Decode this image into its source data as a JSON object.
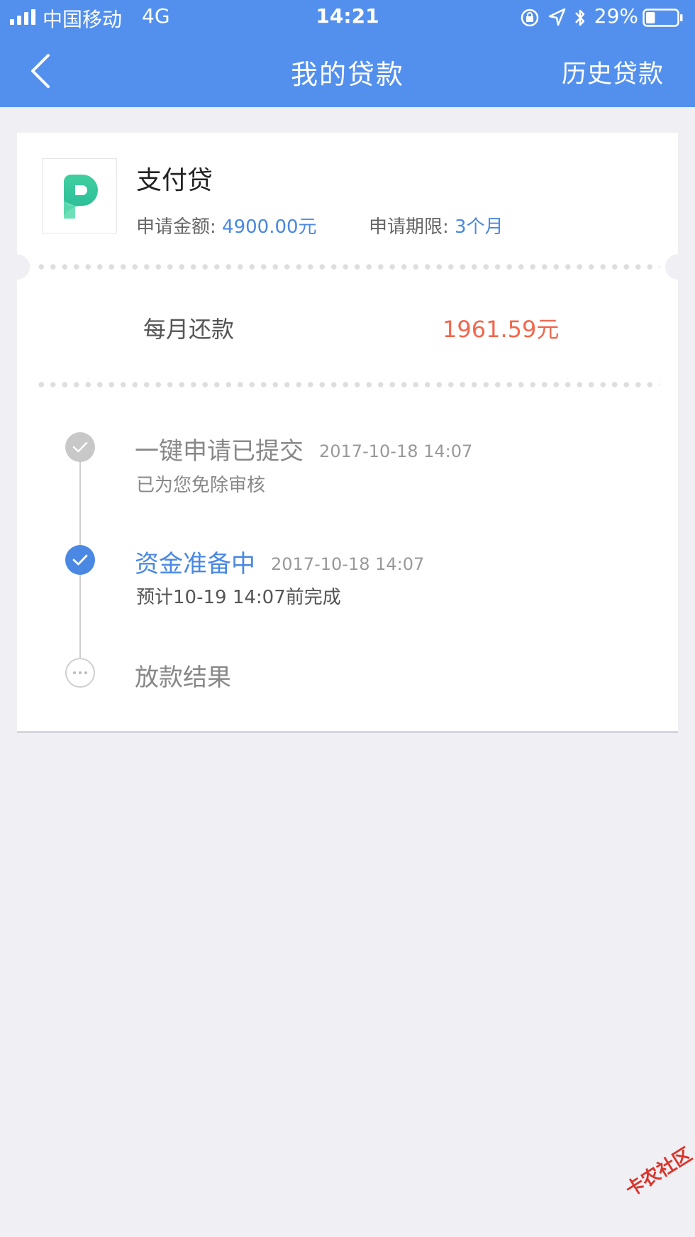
{
  "status_bar": {
    "carrier": "中国移动",
    "network": "4G",
    "time": "14:21",
    "battery_percent": "29%",
    "battery_level": 0.29
  },
  "nav": {
    "title": "我的贷款",
    "history_label": "历史贷款",
    "back_icon": "chevron-left-icon"
  },
  "loan": {
    "logo_icon": "product-logo-p",
    "product_name": "支付贷",
    "amount_label": "申请金额:",
    "amount_value": "4900.00元",
    "period_label": "申请期限:",
    "period_value": "3个月",
    "monthly_label": "每月还款",
    "monthly_value": "1961.59元"
  },
  "timeline": {
    "steps": [
      {
        "title": "一键申请已提交",
        "time": "2017-10-18 14:07",
        "subtitle": "已为您免除审核",
        "status": "done"
      },
      {
        "title": "资金准备中",
        "time": "2017-10-18 14:07",
        "subtitle": "预计10-19 14:07前完成",
        "status": "active"
      },
      {
        "title": "放款结果",
        "status": "pending"
      }
    ]
  },
  "watermark": "卡农社区",
  "colors": {
    "header_bg": "#5390ee",
    "accent_blue": "#4a88e3",
    "amount_red": "#f0684e",
    "page_bg": "#efeff4",
    "logo_green": "#3fcc9b"
  }
}
